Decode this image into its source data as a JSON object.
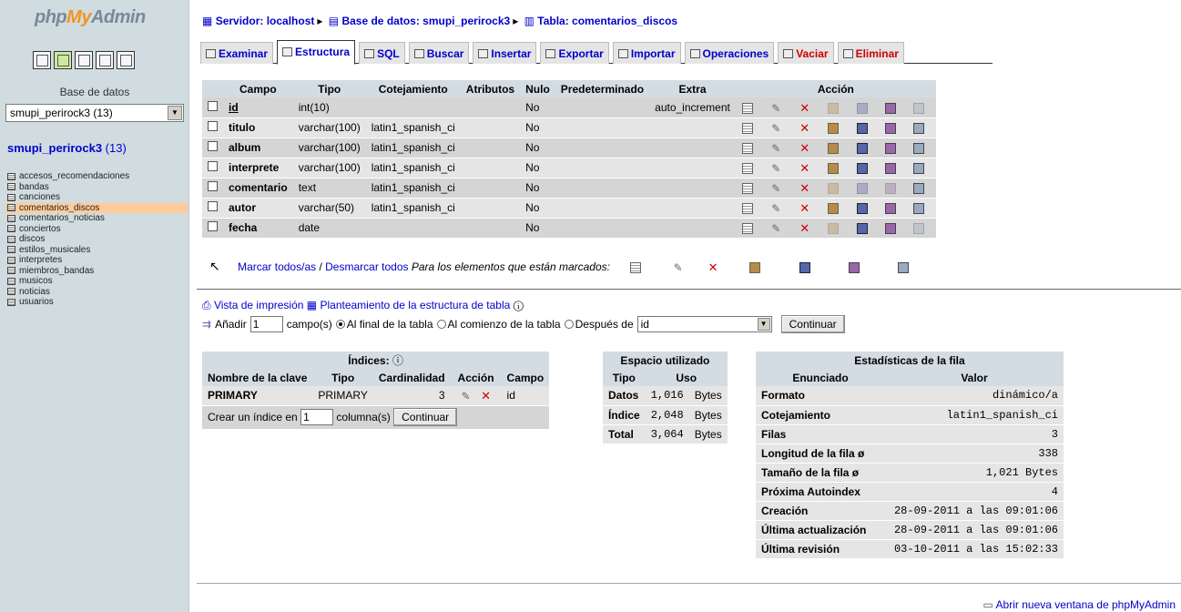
{
  "logo": {
    "php": "php",
    "my": "My",
    "admin": "Admin"
  },
  "left": {
    "db_label": "Base de datos",
    "db_selected": "smupi_perirock3 (13)",
    "db_title": "smupi_perirock3",
    "db_count": "(13)",
    "tables": [
      "accesos_recomendaciones",
      "bandas",
      "canciones",
      "comentarios_discos",
      "comentarios_noticias",
      "conciertos",
      "discos",
      "estilos_musicales",
      "interpretes",
      "miembros_bandas",
      "musicos",
      "noticias",
      "usuarios"
    ]
  },
  "breadcrumb": {
    "server": "Servidor: localhost",
    "db": "Base de datos: smupi_perirock3",
    "table": "Tabla: comentarios_discos"
  },
  "tabs": [
    "Examinar",
    "Estructura",
    "SQL",
    "Buscar",
    "Insertar",
    "Exportar",
    "Importar",
    "Operaciones",
    "Vaciar",
    "Eliminar"
  ],
  "structure": {
    "headers": [
      "Campo",
      "Tipo",
      "Cotejamiento",
      "Atributos",
      "Nulo",
      "Predeterminado",
      "Extra",
      "Acción"
    ],
    "rows": [
      {
        "campo": "id",
        "tipo": "int(10)",
        "cotejamiento": "",
        "atributos": "",
        "nulo": "No",
        "predeterminado": "",
        "extra": "auto_increment"
      },
      {
        "campo": "titulo",
        "tipo": "varchar(100)",
        "cotejamiento": "latin1_spanish_ci",
        "atributos": "",
        "nulo": "No",
        "predeterminado": "",
        "extra": ""
      },
      {
        "campo": "album",
        "tipo": "varchar(100)",
        "cotejamiento": "latin1_spanish_ci",
        "atributos": "",
        "nulo": "No",
        "predeterminado": "",
        "extra": ""
      },
      {
        "campo": "interprete",
        "tipo": "varchar(100)",
        "cotejamiento": "latin1_spanish_ci",
        "atributos": "",
        "nulo": "No",
        "predeterminado": "",
        "extra": ""
      },
      {
        "campo": "comentario",
        "tipo": "text",
        "cotejamiento": "latin1_spanish_ci",
        "atributos": "",
        "nulo": "No",
        "predeterminado": "",
        "extra": ""
      },
      {
        "campo": "autor",
        "tipo": "varchar(50)",
        "cotejamiento": "latin1_spanish_ci",
        "atributos": "",
        "nulo": "No",
        "predeterminado": "",
        "extra": ""
      },
      {
        "campo": "fecha",
        "tipo": "date",
        "cotejamiento": "",
        "atributos": "",
        "nulo": "No",
        "predeterminado": "",
        "extra": ""
      }
    ],
    "mark_all": "Marcar todos/as",
    "slash": " / ",
    "unmark_all": "Desmarcar todos",
    "for_marked": "Para los elementos que están marcados:"
  },
  "tools": {
    "print_view": "Vista de impresión",
    "structure_plan": "Planteamiento de la estructura de tabla",
    "add_label": "Añadir",
    "add_value": "1",
    "fields_label": "campo(s)",
    "opt_end": "Al final de la tabla",
    "opt_start": "Al comienzo de la tabla",
    "opt_after": "Después de",
    "after_field": "id",
    "continue": "Continuar"
  },
  "indexes": {
    "title": "Índices:",
    "headers": [
      "Nombre de la clave",
      "Tipo",
      "Cardinalidad",
      "Acción",
      "Campo"
    ],
    "rows": [
      {
        "name": "PRIMARY",
        "type": "PRIMARY",
        "card": "3",
        "field": "id"
      }
    ],
    "create_label": "Crear un índice en",
    "create_value": "1",
    "cols_label": "columna(s)",
    "continue": "Continuar"
  },
  "space": {
    "title": "Espacio utilizado",
    "headers": [
      "Tipo",
      "Uso"
    ],
    "rows": [
      {
        "type": "Datos",
        "value": "1,016",
        "unit": "Bytes"
      },
      {
        "type": "Índice",
        "value": "2,048",
        "unit": "Bytes"
      },
      {
        "type": "Total",
        "value": "3,064",
        "unit": "Bytes"
      }
    ]
  },
  "stats": {
    "title": "Estadísticas de la fila",
    "headers": [
      "Enunciado",
      "Valor"
    ],
    "rows": [
      {
        "label": "Formato",
        "value": "dinámico/a"
      },
      {
        "label": "Cotejamiento",
        "value": "latin1_spanish_ci"
      },
      {
        "label": "Filas",
        "value": "3"
      },
      {
        "label": "Longitud de la fila ø",
        "value": "338"
      },
      {
        "label": "Tamaño de la fila ø",
        "value": "1,021 Bytes"
      },
      {
        "label": "Próxima Autoindex",
        "value": "4"
      },
      {
        "label": "Creación",
        "value": "28-09-2011 a las 09:01:06"
      },
      {
        "label": "Última actualización",
        "value": "28-09-2011 a las 09:01:06"
      },
      {
        "label": "Última revisión",
        "value": "03-10-2011 a las 15:02:33"
      }
    ]
  },
  "footer": {
    "new_window": "Abrir nueva ventana de phpMyAdmin"
  }
}
